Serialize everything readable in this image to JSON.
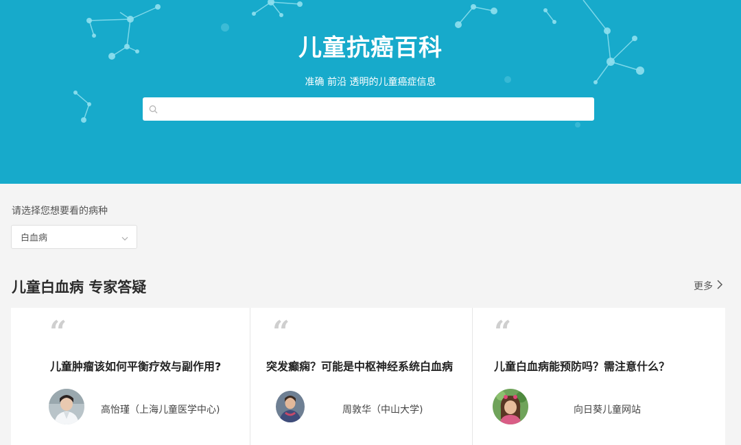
{
  "hero": {
    "title": "儿童抗癌百科",
    "subtitle": "准确 前沿 透明的儿童癌症信息",
    "search": {
      "placeholder": "",
      "value": ""
    },
    "background_color": "#17aacb"
  },
  "filter": {
    "label": "请选择您想要看的病种",
    "selected": "白血病"
  },
  "section": {
    "title": "儿童白血病 专家答疑",
    "more_label": "更多"
  },
  "cards": [
    {
      "quote": "“",
      "question": "儿童肿瘤该如何平衡疗效与副作用?",
      "author": "高怡瑾（上海儿童医学中心)"
    },
    {
      "quote": "“",
      "question": "突发癫痫？可能是中枢神经系统白血病",
      "author": "周敦华（中山大学)"
    },
    {
      "quote": "“",
      "question": "儿童白血病能预防吗？需注意什么？",
      "author": "向日葵儿童网站"
    }
  ],
  "icons": {
    "search": "search-icon",
    "dropdown": "chevron-down-icon",
    "more": "chevron-right-icon"
  }
}
